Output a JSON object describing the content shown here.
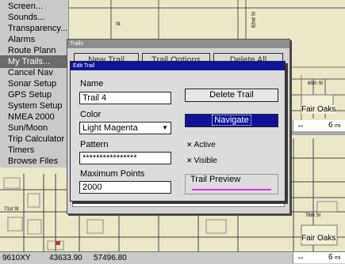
{
  "system_menu": {
    "items": [
      "Screen...",
      "Sounds...",
      "Transparency...",
      "Alarms",
      "Route Plann",
      "My Trails...",
      "Cancel Nav",
      "Sonar Setup",
      "GPS Setup",
      "System Setup",
      "NMEA 2000",
      "Sun/Moon",
      "Trip Calculator",
      "Timers",
      "Browse Files"
    ],
    "selected_index": 5
  },
  "trails_window": {
    "title": "Trails",
    "new_trail": "New Trail",
    "trail_options": "Trail Options",
    "delete_all": "Delete All"
  },
  "edit_trail": {
    "title": "Edit Trail",
    "name_label": "Name",
    "name_value": "Trail 4",
    "color_label": "Color",
    "color_value": "Light Magenta",
    "pattern_label": "Pattern",
    "pattern_value": "****************",
    "max_points_label": "Maximum Points",
    "max_points_value": "2000",
    "delete_trail": "Delete Trail",
    "navigate": "Navigate",
    "active_label": "Active",
    "active_checked": true,
    "visible_label": "Visible",
    "visible_checked": true,
    "preview_label": "Trail Preview",
    "preview_color": "#e030e0",
    "check_glyph": "✕"
  },
  "map": {
    "labels": {
      "fair_oaks": "Fair Oaks",
      "road_65th": "65th St",
      "road_left": "St",
      "road_71st": "71st St",
      "road_76th": "76th St",
      "road_vert": "82nd St"
    }
  },
  "scale_top": {
    "arrow": "↔",
    "value": "6",
    "unit": "mi"
  },
  "status_bar": {
    "left": "9610XY",
    "lat": "43633.90",
    "lon": "57496.80",
    "arrow": "↔",
    "scale": "6",
    "unit": "mi"
  }
}
